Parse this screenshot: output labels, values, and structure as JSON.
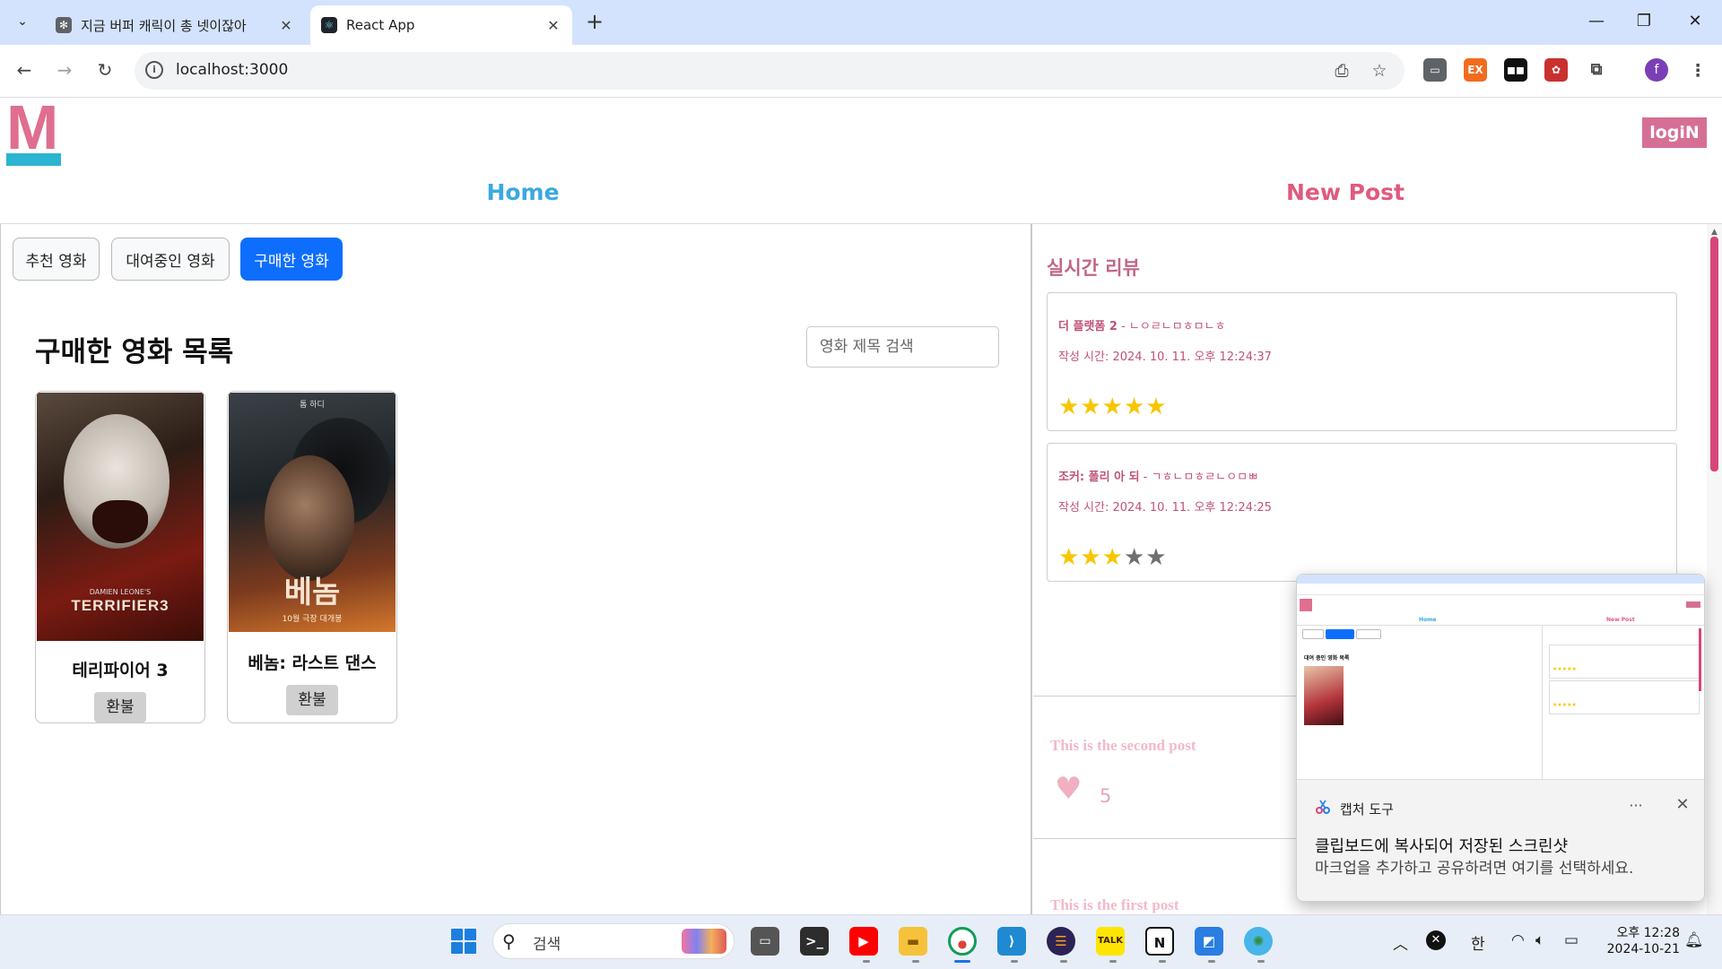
{
  "browser": {
    "tabs": [
      {
        "title": "지금 버퍼 캐릭이 총 넷이잖아",
        "active": false
      },
      {
        "title": "React App",
        "active": true
      }
    ],
    "url": "localhost:3000",
    "profile_initial": "f"
  },
  "header": {
    "logo_letter": "M",
    "login_label": "logiN",
    "nav": {
      "home": "Home",
      "new_post": "New Post"
    }
  },
  "movies_panel": {
    "tabs": [
      {
        "label": "추천 영화",
        "active": false
      },
      {
        "label": "대여중인 영화",
        "active": false
      },
      {
        "label": "구매한 영화",
        "active": true
      }
    ],
    "title": "구매한 영화 목록",
    "search_placeholder": "영화 제목 검색",
    "movies": [
      {
        "name": "테리파이어 3",
        "button": "환불",
        "poster_text": "TERRIFIER3",
        "poster_sub": "DAMIEN LEONE'S"
      },
      {
        "name": "베놈: 라스트 댄스",
        "button": "환불",
        "poster_text": "베놈",
        "poster_top": "톰 하디",
        "poster_sub": "10월 극장 대개봉"
      }
    ]
  },
  "reviews_panel": {
    "title": "실시간 리뷰",
    "reviews": [
      {
        "movie": "더 플랫폼 2",
        "text": " - ㄴㅇㄹㄴㅁㅎㅁㄴㅎ",
        "time": "작성 시간: 2024. 10. 11. 오후 12:24:37",
        "rating": 5
      },
      {
        "movie": "조커: 폴리 아 되",
        "text": " - ㄱㅎㄴㅁㅎㄹㄴㅇㅁㅃ",
        "time": "작성 시간: 2024. 10. 11. 오후 12:24:25",
        "rating": 3
      }
    ],
    "posts": [
      {
        "title": "This is the second post",
        "likes": "5"
      },
      {
        "title": "This is the first post"
      }
    ]
  },
  "notification": {
    "app_name": "캡처 도구",
    "more": "···",
    "close": "✕",
    "headline": "클립보드에 복사되어 저장된 스크린샷",
    "body": "마크업을 추가하고 공유하려면 여기를 선택하세요.",
    "thumbnail": {
      "home": "Home",
      "new_post": "New Post",
      "heading": "대여 중인 영화 목록"
    }
  },
  "taskbar": {
    "search_placeholder": "검색",
    "ime": "한",
    "time": "오후 12:28",
    "date": "2024-10-21"
  },
  "colors": {
    "accent_blue": "#0d6efd",
    "home_link": "#3aa9e0",
    "new_post_link": "#e05a7f",
    "review_text": "#c0527a",
    "star_on": "#f7c600",
    "star_off": "#707070",
    "login_bg": "#d66f95"
  }
}
